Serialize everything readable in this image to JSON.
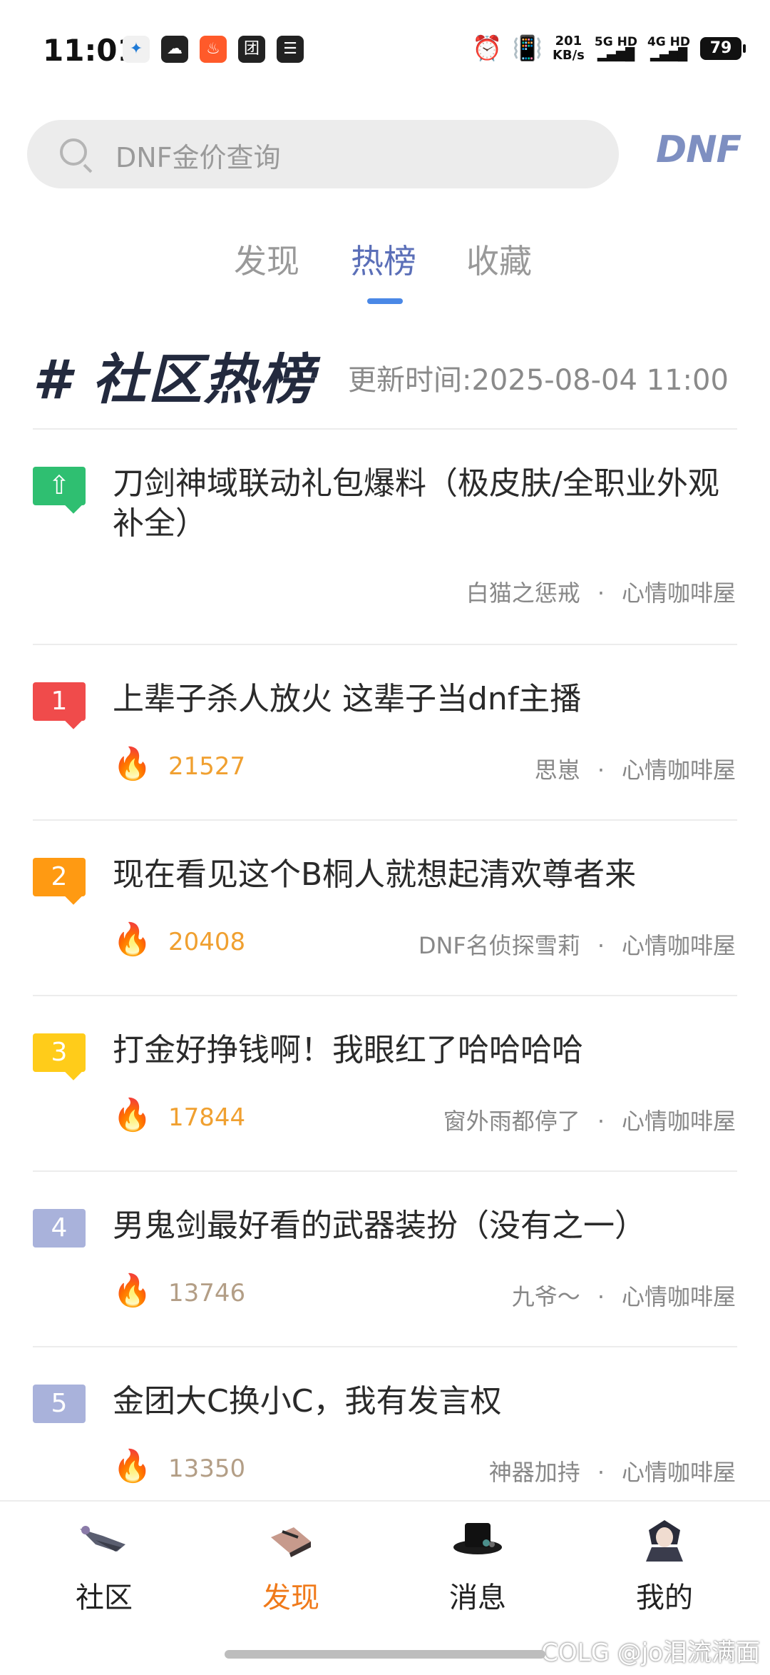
{
  "status_bar": {
    "time": "11:01",
    "app_icons": [
      "✦",
      "☁",
      "♨",
      "团",
      "☰"
    ],
    "speed_value": "201",
    "speed_unit": "KB/s",
    "net1": "5G HD",
    "net2": "4G HD",
    "battery": "79"
  },
  "search": {
    "placeholder": "DNF金价查询",
    "game_logo": "DNF"
  },
  "tabs": [
    {
      "label": "发现",
      "active": false
    },
    {
      "label": "热榜",
      "active": true
    },
    {
      "label": "收藏",
      "active": false
    }
  ],
  "hot": {
    "title": "# 社区热榜",
    "update_time": "更新时间:2025-08-04 11:00"
  },
  "items": [
    {
      "rank": "⇧",
      "badge_color": "#2fbf71",
      "title": "刀剑神域联动礼包爆料（极皮肤/全职业外观补全）",
      "heat": "",
      "author": "白猫之惩戒",
      "board": "心情咖啡屋"
    },
    {
      "rank": "1",
      "badge_color": "#f04b4b",
      "title": "上辈子杀人放火 这辈子当dnf主播",
      "heat": "21527",
      "heat_color": "#f0a030",
      "author": "思崽",
      "board": "心情咖啡屋"
    },
    {
      "rank": "2",
      "badge_color": "#ff9a12",
      "title": "现在看见这个B桐人就想起清欢尊者来",
      "heat": "20408",
      "heat_color": "#f0a030",
      "author": "DNF名侦探雪莉",
      "board": "心情咖啡屋"
    },
    {
      "rank": "3",
      "badge_color": "#ffcc1a",
      "title": "打金好挣钱啊！我眼红了哈哈哈哈",
      "heat": "17844",
      "heat_color": "#f0a030",
      "author": "窗外雨都停了",
      "board": "心情咖啡屋"
    },
    {
      "rank": "4",
      "badge_color": "#a9b2db",
      "title": "男鬼剑最好看的武器装扮（没有之一）",
      "heat": "13746",
      "heat_color": "#b39e86",
      "author": "九爷～",
      "board": "心情咖啡屋"
    },
    {
      "rank": "5",
      "badge_color": "#a9b2db",
      "title": "金团大C换小C，我有发言权",
      "heat": "13350",
      "heat_color": "#b39e86",
      "author": "神器加持",
      "board": "心情咖啡屋"
    }
  ],
  "bottom_nav": [
    {
      "label": "社区",
      "icon": "community-icon",
      "active": false
    },
    {
      "label": "发现",
      "icon": "discover-icon",
      "active": true
    },
    {
      "label": "消息",
      "icon": "message-icon",
      "active": false
    },
    {
      "label": "我的",
      "icon": "profile-icon",
      "active": false
    }
  ],
  "watermark": "COLG @jo泪流满面",
  "colors": {
    "accent_tab": "#5b6fb8",
    "indicator": "#4a88e6",
    "active_nav": "#f07a1a"
  }
}
